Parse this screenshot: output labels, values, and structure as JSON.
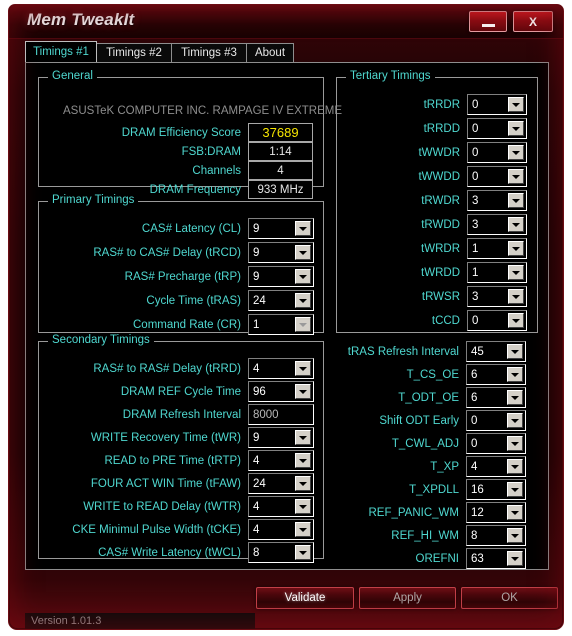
{
  "window": {
    "title": "Mem TweakIt",
    "minimize_label": "minimize",
    "close_label": "X"
  },
  "tabs": [
    {
      "label": "Timings #1",
      "active": true
    },
    {
      "label": "Timings #2",
      "active": false
    },
    {
      "label": "Timings #3",
      "active": false
    },
    {
      "label": "About",
      "active": false
    }
  ],
  "general": {
    "title": "General",
    "machine": "ASUSTeK COMPUTER INC. RAMPAGE IV EXTREME",
    "rows": [
      {
        "label": "DRAM Efficiency Score",
        "value": "37689",
        "accent": true
      },
      {
        "label": "FSB:DRAM",
        "value": "1:14",
        "accent": false
      },
      {
        "label": "Channels",
        "value": "4",
        "accent": false
      },
      {
        "label": "DRAM Frequency",
        "value": "933 MHz",
        "accent": false
      }
    ]
  },
  "primary": {
    "title": "Primary Timings",
    "rows": [
      {
        "label": "CAS# Latency (CL)",
        "value": "9",
        "disabled": false
      },
      {
        "label": "RAS# to CAS# Delay (tRCD)",
        "value": "9",
        "disabled": false
      },
      {
        "label": "RAS# Precharge (tRP)",
        "value": "9",
        "disabled": false
      },
      {
        "label": "Cycle Time (tRAS)",
        "value": "24",
        "disabled": false
      },
      {
        "label": "Command Rate (CR)",
        "value": "1",
        "disabled": true
      }
    ]
  },
  "secondary": {
    "title": "Secondary Timings",
    "rows": [
      {
        "label": "RAS# to RAS# Delay (tRRD)",
        "value": "4",
        "type": "combo"
      },
      {
        "label": "DRAM REF Cycle Time",
        "value": "96",
        "type": "combo"
      },
      {
        "label": "DRAM Refresh Interval",
        "value": "8000",
        "type": "text"
      },
      {
        "label": "WRITE Recovery Time (tWR)",
        "value": "9",
        "type": "combo"
      },
      {
        "label": "READ to PRE Time (tRTP)",
        "value": "4",
        "type": "combo"
      },
      {
        "label": "FOUR ACT WIN Time (tFAW)",
        "value": "24",
        "type": "combo"
      },
      {
        "label": "WRITE to READ Delay (tWTR)",
        "value": "4",
        "type": "combo"
      },
      {
        "label": "CKE Minimul Pulse Width (tCKE)",
        "value": "4",
        "type": "combo"
      },
      {
        "label": "CAS# Write Latency (tWCL)",
        "value": "8",
        "type": "combo"
      }
    ]
  },
  "tertiary": {
    "title": "Tertiary Timings",
    "rows": [
      {
        "label": "tRRDR",
        "value": "0"
      },
      {
        "label": "tRRDD",
        "value": "0"
      },
      {
        "label": "tWWDR",
        "value": "0"
      },
      {
        "label": "tWWDD",
        "value": "0"
      },
      {
        "label": "tRWDR",
        "value": "3"
      },
      {
        "label": "tRWDD",
        "value": "3"
      },
      {
        "label": "tWRDR",
        "value": "1"
      },
      {
        "label": "tWRDD",
        "value": "1"
      },
      {
        "label": "tRWSR",
        "value": "3"
      },
      {
        "label": "tCCD",
        "value": "0"
      }
    ]
  },
  "misc": {
    "rows": [
      {
        "label": "tRAS Refresh Interval",
        "value": "45"
      },
      {
        "label": "T_CS_OE",
        "value": "6"
      },
      {
        "label": "T_ODT_OE",
        "value": "6"
      },
      {
        "label": "Shift ODT Early",
        "value": "0"
      },
      {
        "label": "T_CWL_ADJ",
        "value": "0"
      },
      {
        "label": "T_XP",
        "value": "4"
      },
      {
        "label": "T_XPDLL",
        "value": "16"
      },
      {
        "label": "REF_PANIC_WM",
        "value": "12"
      },
      {
        "label": "REF_HI_WM",
        "value": "8"
      },
      {
        "label": "OREFNI",
        "value": "63"
      }
    ]
  },
  "buttons": {
    "validate": "Validate",
    "apply": "Apply",
    "ok": "OK"
  },
  "status": {
    "version": "Version 1.01.3"
  },
  "colors": {
    "accent_cyan": "#4fd8d0",
    "accent_yellow": "#f5e400",
    "brand_red": "#8c0d13"
  }
}
